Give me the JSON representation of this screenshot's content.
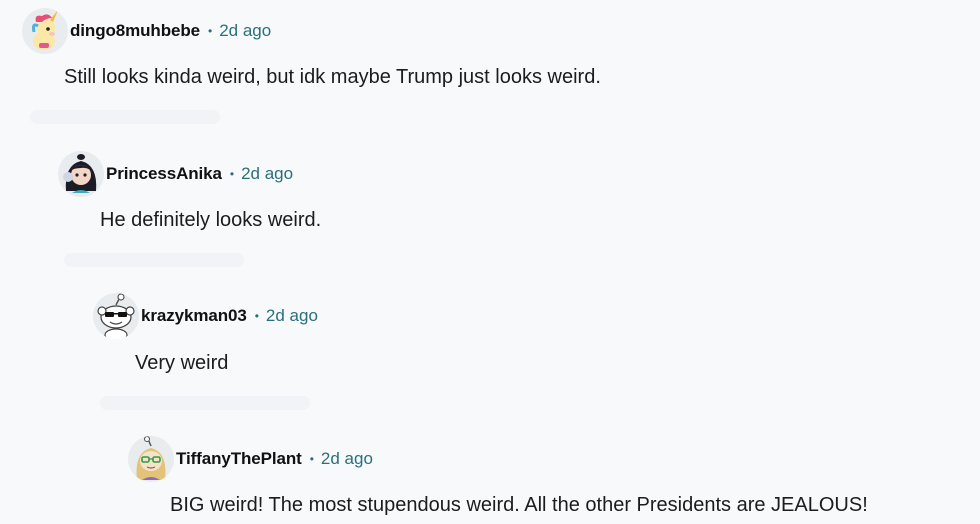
{
  "comments": [
    {
      "username": "dingo8muhbebe",
      "separator": "•",
      "time": "2d ago",
      "body": "Still looks kinda weird, but idk maybe Trump just looks weird.",
      "avatar": "unicorn-avatar-icon"
    },
    {
      "username": "PrincessAnika",
      "separator": "•",
      "time": "2d ago",
      "body": "He definitely looks weird.",
      "avatar": "dark-haired-avatar-icon"
    },
    {
      "username": "krazykman03",
      "separator": "•",
      "time": "2d ago",
      "body": "Very weird",
      "avatar": "sunglasses-snoo-avatar-icon"
    },
    {
      "username": "TiffanyThePlant",
      "separator": "•",
      "time": "2d ago",
      "body": "BIG weird! The most stupendous weird. All the other Presidents are JEALOUS!",
      "avatar": "glasses-blonde-avatar-icon"
    }
  ],
  "colors": {
    "background": "#f8f9fb",
    "username": "#111111",
    "timestamp": "#2a6f7a",
    "body_text": "#1c1c1c"
  }
}
